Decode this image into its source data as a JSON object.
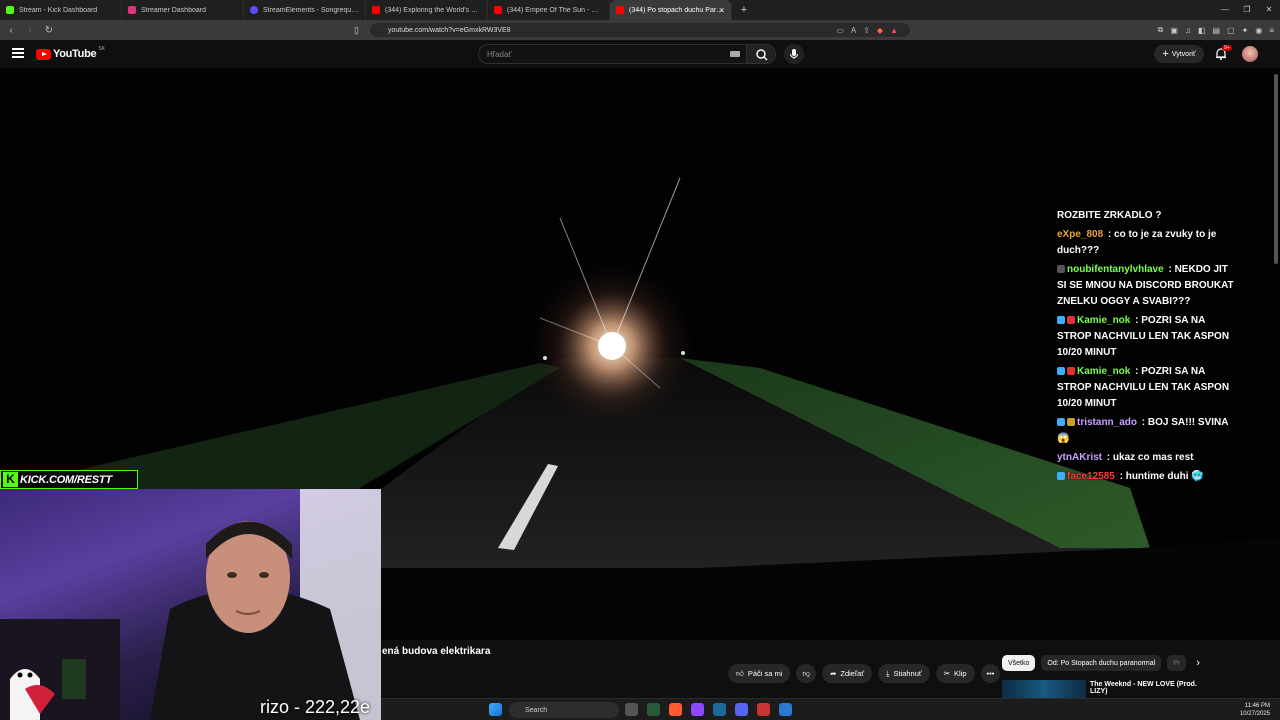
{
  "browser": {
    "tabs": [
      {
        "title": "Stream - Kick Dashboard",
        "color": "#53fc18"
      },
      {
        "title": "Streamer Dashboard",
        "color": "#e0337e"
      },
      {
        "title": "StreamElements - Songrequest",
        "color": "#5b4cff"
      },
      {
        "title": "(344) Exploring the World's Largest S",
        "color": "#ff0000"
      },
      {
        "title": "(344) Empire Of The Sun - We Are Th",
        "color": "#ff0000"
      },
      {
        "title": "(344) Po stopach duchu Paranor",
        "color": "#ff0000",
        "active": true
      }
    ],
    "url": "youtube.com/watch?v=eGmxkRW3VE8"
  },
  "youtube": {
    "logo_text": "YouTube",
    "region": "SK",
    "search_placeholder": "Hľadať",
    "create_label": "Vytvoriť",
    "notif_count": "9+"
  },
  "chat": [
    {
      "user": "",
      "text": "ROZBITE ZRKADLO ?",
      "user_color": "#ffffff"
    },
    {
      "user": "eXpe_808",
      "text": " : co to je za zvuky to je duch???",
      "user_color": "#e8a33c"
    },
    {
      "user": "noubifentanylvhlave",
      "text": " : NEKDO JIT SI SE MNOU NA DISCORD BROUKAT ZNELKU OGGY A SVABI???",
      "user_color": "#7cff4f"
    },
    {
      "user": "Kamie_nok",
      "text": " : POZRI SA NA STROP NACHVILU LEN TAK ASPON 10/20 MINUT",
      "user_color": "#7cff4f"
    },
    {
      "user": "Kamie_nok",
      "text": " : POZRI SA NA STROP NACHVILU LEN TAK ASPON 10/20 MINUT",
      "user_color": "#7cff4f"
    },
    {
      "user": "tristann_ado",
      "text": " : BOJ SA!!! SVINA 😱",
      "user_color": "#c9a0ff"
    },
    {
      "user": "ytnAKrist",
      "text": " : ukaz co mas rest",
      "user_color": "#c9a0ff"
    },
    {
      "user": "face12585",
      "text": " : huntime duhi 🥶",
      "user_color": "#ff3b3b"
    }
  ],
  "webcam": {
    "kick_label": "KICK.COM/RESTT",
    "caption": "rizo - 222,22e"
  },
  "video": {
    "title_visible": "ená budova elektrikara",
    "actions": {
      "like": "Páči sa mi",
      "share": "Zdieľať",
      "download": "Stiahnuť",
      "clip": "Klip"
    }
  },
  "sidebar": {
    "chips": [
      "Všetko",
      "Od: Po Stopach duchu paranormal",
      "Pr"
    ],
    "rec_title": "The Weeknd - NEW LOVE (Prod. LIZY)"
  },
  "taskbar": {
    "search_label": "Search",
    "time": "11:46 PM",
    "date": "10/27/2025"
  }
}
